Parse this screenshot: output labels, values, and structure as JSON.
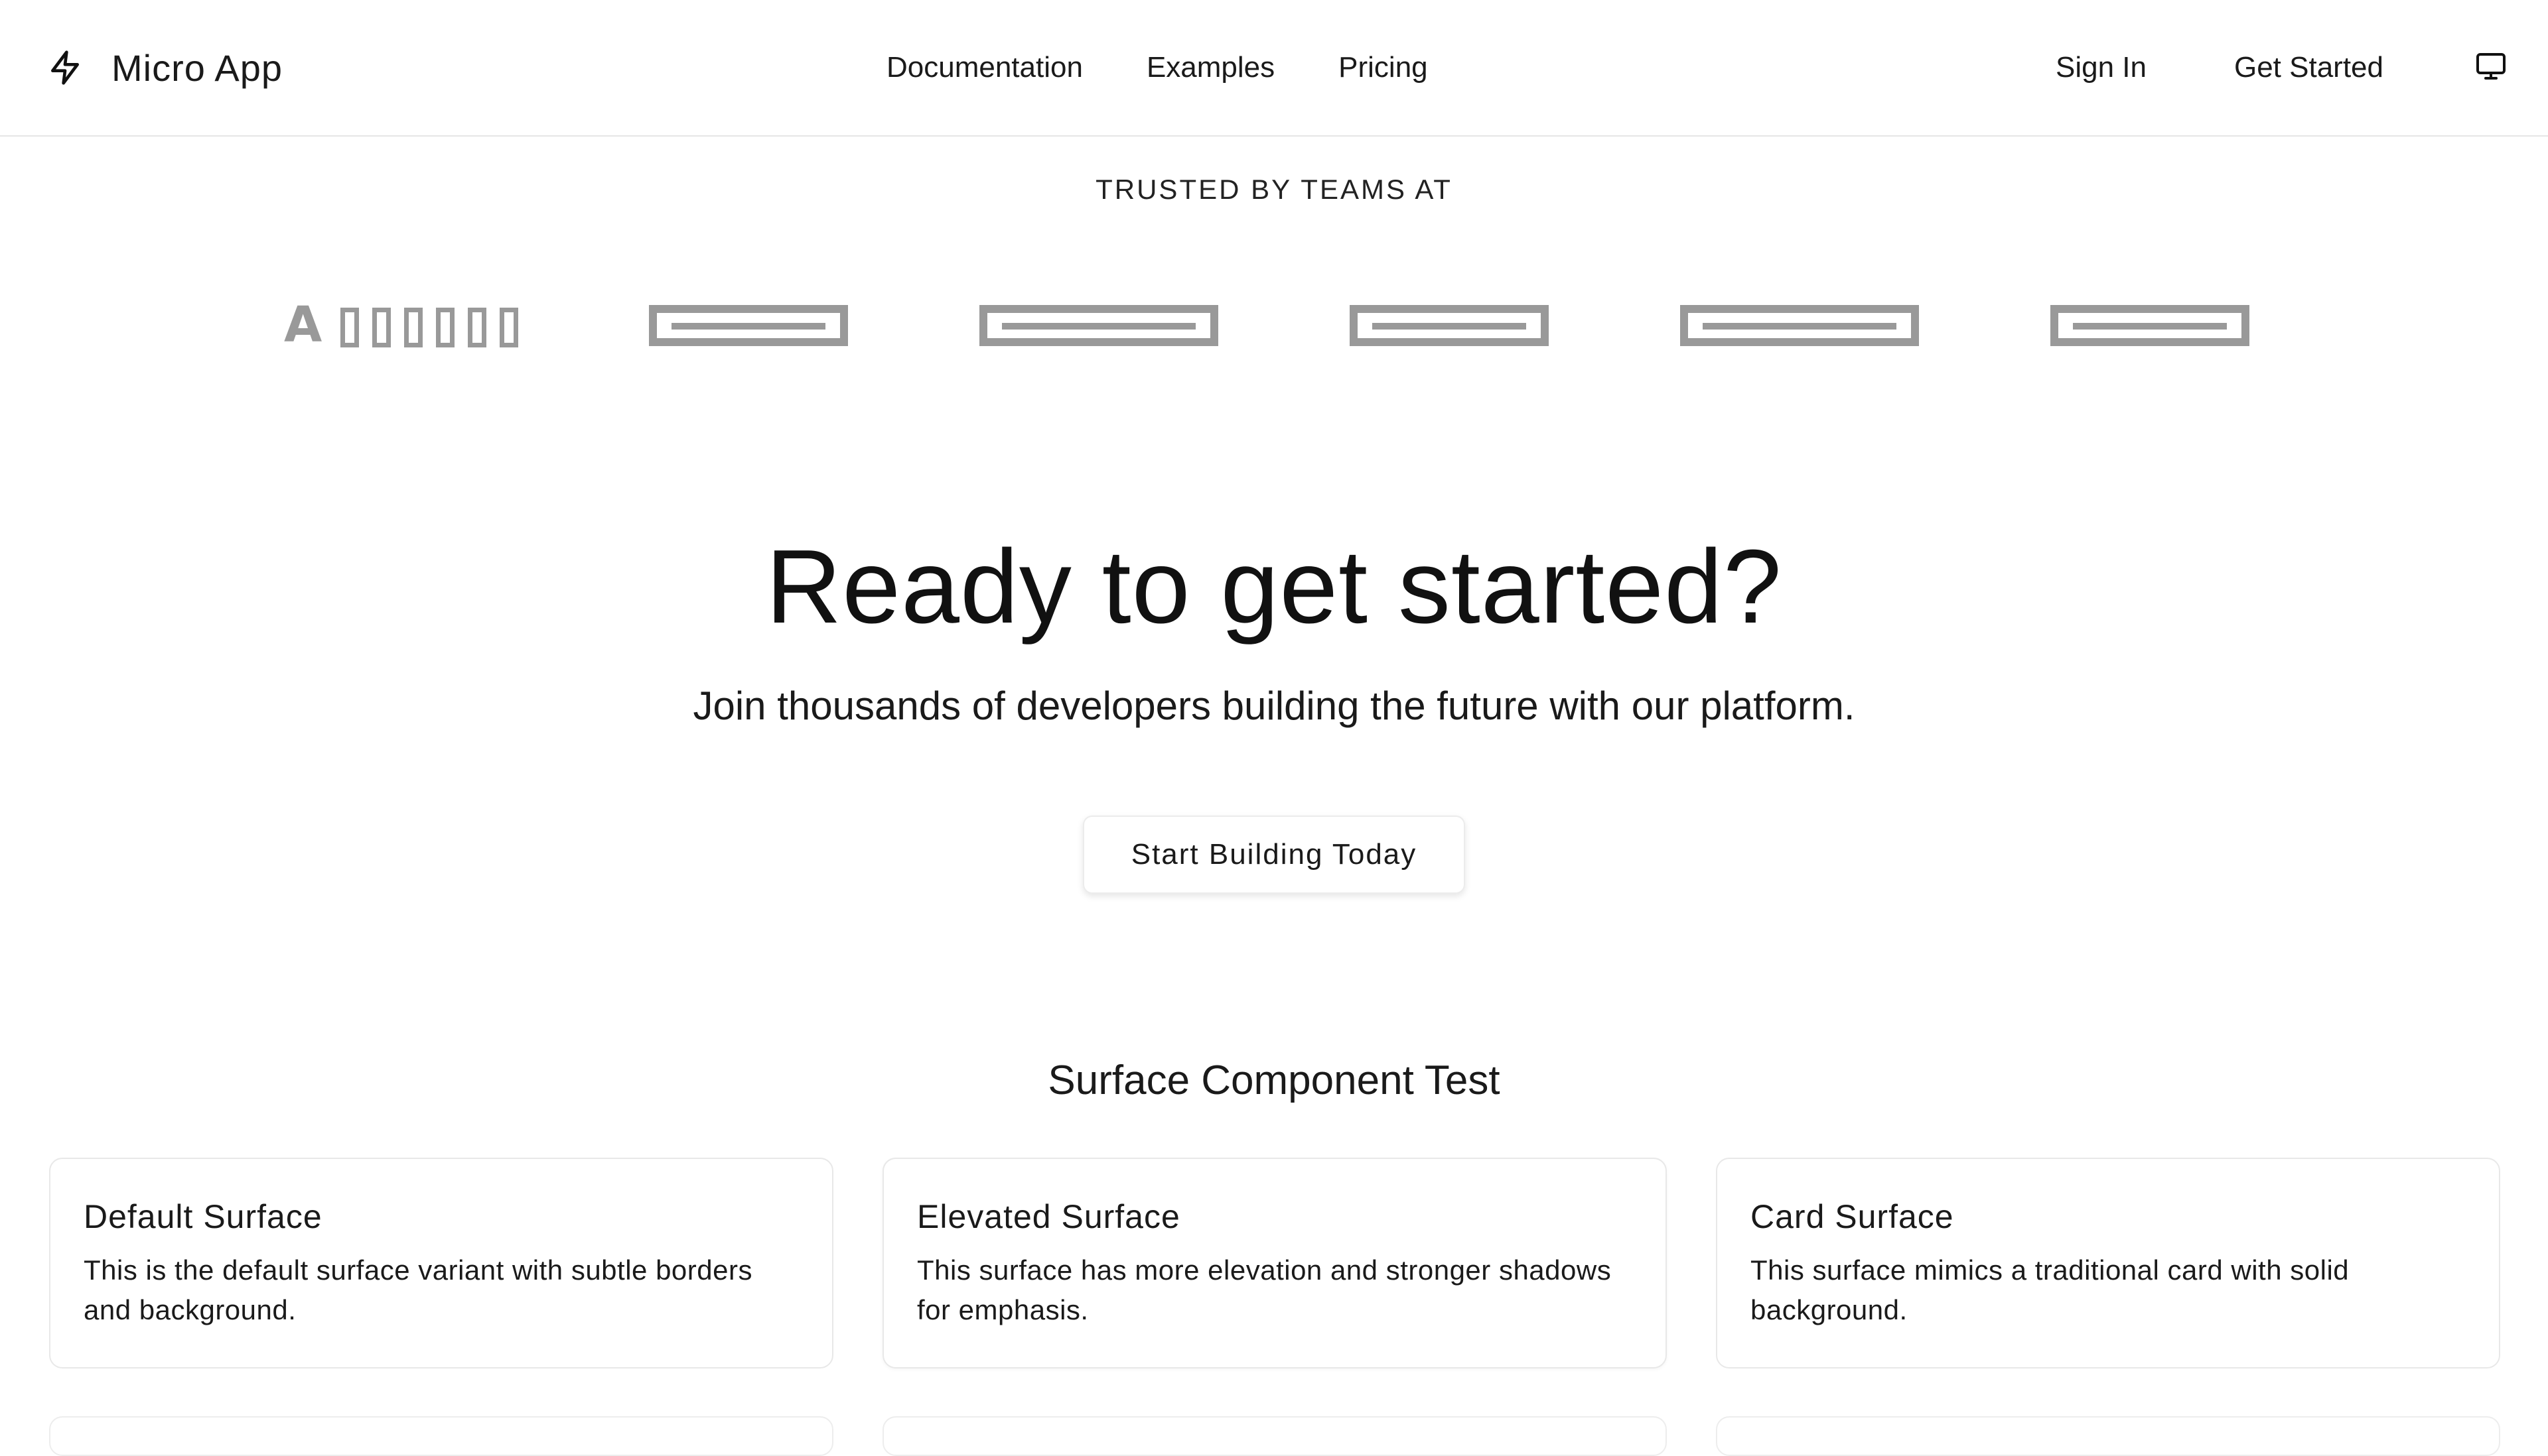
{
  "header": {
    "brand_name": "Micro App",
    "brand_icon": "lightning-icon",
    "nav_links": [
      "Documentation",
      "Examples",
      "Pricing"
    ],
    "sign_in_label": "Sign In",
    "get_started_label": "Get Started",
    "theme_icon": "monitor-icon"
  },
  "trusted": {
    "label": "TRUSTED BY TEAMS AT",
    "logo_first_letter": "A",
    "logo_color": "#999999"
  },
  "cta": {
    "title": "Ready to get started?",
    "subtitle": "Join thousands of developers building the future with our platform.",
    "button_label": "Start Building Today"
  },
  "surfaces": {
    "heading": "Surface Component Test",
    "cards": [
      {
        "title": "Default Surface",
        "text": "This is the default surface variant with subtle borders and background."
      },
      {
        "title": "Elevated Surface",
        "text": "This surface has more elevation and stronger shadows for emphasis."
      },
      {
        "title": "Card Surface",
        "text": "This surface mimics a traditional card with solid background."
      }
    ]
  }
}
